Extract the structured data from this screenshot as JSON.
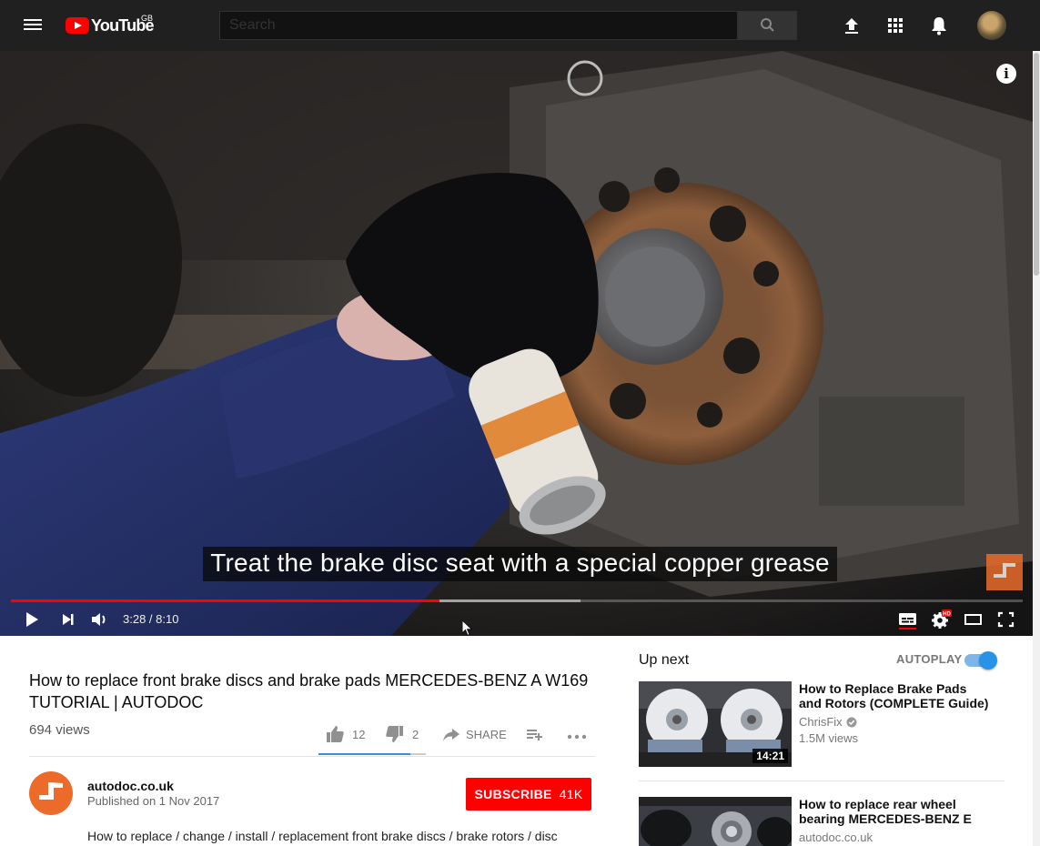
{
  "masthead": {
    "logo_text": "YouTube",
    "region": "GB",
    "search_placeholder": "Search",
    "icons": [
      "menu-icon",
      "upload-icon",
      "apps-icon",
      "notifications-icon",
      "search-icon"
    ]
  },
  "player": {
    "caption": "Treat the brake disc seat with a special copper grease",
    "current_time": "3:28",
    "duration": "8:10",
    "time_display": "3:28 / 8:10",
    "played_fraction": 0.424,
    "loaded_fraction": 0.563,
    "hd_badge": "HD",
    "info_glyph": "i"
  },
  "video": {
    "title": "How to replace front brake discs and brake pads MERCEDES-BENZ A W169 TUTORIAL | AUTODOC",
    "views": "694 views",
    "likes": "12",
    "dislikes": "2",
    "share_label": "SHARE",
    "like_fraction": 0.857
  },
  "channel": {
    "name": "autodoc.co.uk",
    "published": "Published on 1 Nov 2017",
    "subscribe_label": "SUBSCRIBE",
    "subscriber_count": "41K",
    "description": "How to replace / change / install / replacement front brake discs / brake rotors / disc"
  },
  "sidebar": {
    "up_next_label": "Up next",
    "autoplay_label": "AUTOPLAY",
    "autoplay_on": true,
    "recommendations": [
      {
        "title": "How to Replace Brake Pads and Rotors (COMPLETE Guide)",
        "channel": "ChrisFix",
        "verified": true,
        "views": "1.5M views",
        "duration": "14:21"
      },
      {
        "title": "How to replace rear wheel bearing MERCEDES-BENZ E",
        "channel": "autodoc.co.uk",
        "verified": false,
        "views": "",
        "duration": ""
      }
    ]
  },
  "colors": {
    "brand_red": "#ff0000",
    "masthead_bg": "#202020",
    "autoplay_blue": "#2793e6",
    "like_bar": "#3b8ddb"
  }
}
